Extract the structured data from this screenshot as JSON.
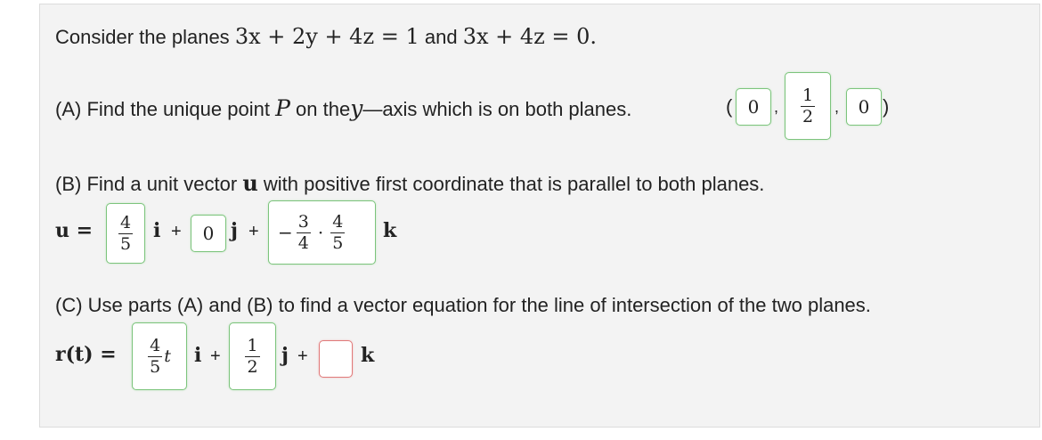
{
  "problem": {
    "intro_text": "Consider the planes",
    "plane1": "3x + 2y + 4z = 1",
    "and_text": "and",
    "plane2": "3x + 4z = 0."
  },
  "part_a": {
    "prompt_before": "(A) Find the unique point",
    "point_symbol": "P",
    "prompt_middle": "on the",
    "axis_symbol": "y",
    "prompt_after": "—axis which is on both planes.",
    "open_paren": "(",
    "close_paren": ")",
    "comma": ",",
    "x_value": "0",
    "y_num": "1",
    "y_den": "2",
    "z_value": "0"
  },
  "part_b": {
    "prompt_before": "(B) Find a unit vector",
    "vector_symbol": "u",
    "prompt_after": "with positive first coordinate that is parallel to both planes.",
    "lhs": "u =",
    "i_comp_num": "4",
    "i_comp_den": "5",
    "i_label": "i",
    "plus": "+",
    "j_comp": "0",
    "j_label": "j",
    "k_sign": "−",
    "k_frac1_num": "3",
    "k_frac1_den": "4",
    "k_dot": "·",
    "k_frac2_num": "4",
    "k_frac2_den": "5",
    "k_label": "k"
  },
  "part_c": {
    "prompt": "(C) Use parts (A) and (B) to find a vector equation for the line of intersection of the two planes.",
    "lhs": "r(t) =",
    "i_comp_num": "4",
    "i_comp_den": "5",
    "i_comp_var": "t",
    "i_label": "i",
    "plus": "+",
    "j_comp_num": "1",
    "j_comp_den": "2",
    "j_label": "j",
    "k_comp": "",
    "k_label": "k"
  },
  "colors": {
    "panel_bg": "#f3f3f3",
    "correct_border": "#7cc47c",
    "empty_border": "#e07a7a"
  }
}
